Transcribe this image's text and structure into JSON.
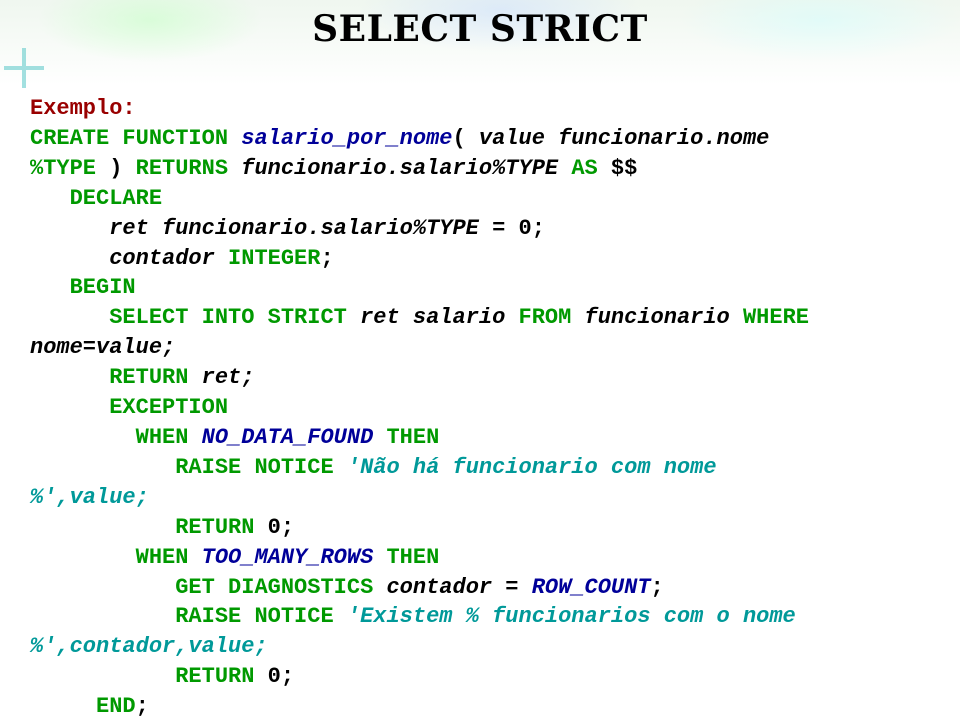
{
  "title": "SELECT STRICT",
  "label": "Exemplo:",
  "tokens": {
    "create": "CREATE",
    "function": "FUNCTION",
    "salario_por_nome": "salario_por_nome",
    "lparen": "(",
    "value": "value",
    "funcionario_dot_nome": "funcionario.nome",
    "type_kw": "%TYPE",
    "rparen": ")",
    "returns": "RETURNS",
    "funcionario_dot_salario_type": "funcionario.salario%TYPE",
    "as": "AS",
    "dollars": "$$",
    "declare": "DECLARE",
    "ret": "ret",
    "eq_zero": " = 0;",
    "contador": "contador",
    "integer": "INTEGER",
    "semi": ";",
    "begin": "BEGIN",
    "select": "SELECT",
    "into": "INTO",
    "strict": "STRICT",
    "ret2": "ret",
    "salario": "salario",
    "from": "FROM",
    "funcionario": "funcionario",
    "where": "WHERE",
    "nome_eq_value": "nome=value;",
    "return": "RETURN",
    "ret_semi": "ret;",
    "exception": "EXCEPTION",
    "when": "WHEN",
    "no_data_found": "NO_DATA_FOUND",
    "then": "THEN",
    "raise": "RAISE",
    "notice": "NOTICE",
    "str1": "'Não há funcionario com nome ",
    "pct_close_value": "%',value;",
    "zero_semi": "0;",
    "too_many_rows": "TOO_MANY_ROWS",
    "get": "GET",
    "diagnostics": "DIAGNOSTICS",
    "row_count": "ROW_COUNT",
    "eq": " = ",
    "str2": "'Existem % funcionarios com o nome ",
    "pct_close_contador_value": "%',contador,value;",
    "end": "END",
    "end_semi": ";"
  }
}
